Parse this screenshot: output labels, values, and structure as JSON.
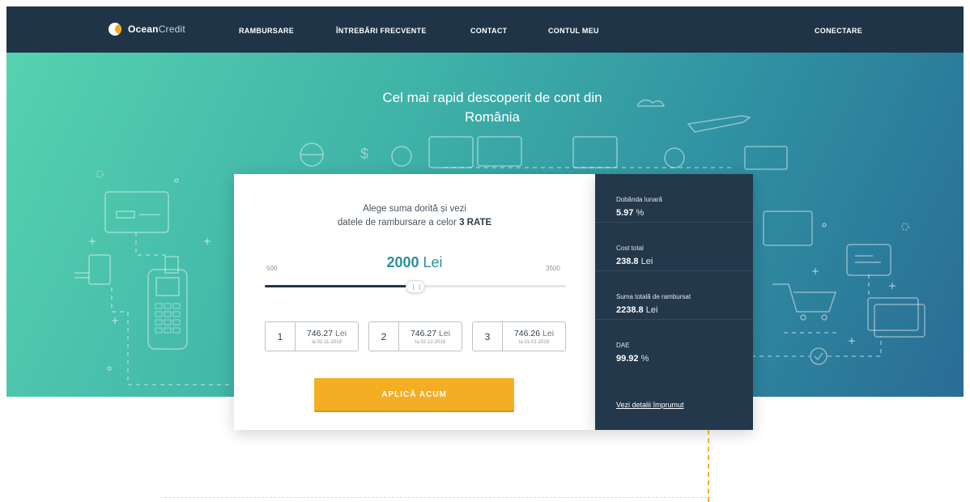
{
  "nav": {
    "brand_bold": "Ocean",
    "brand_light": "Credit",
    "links": [
      "RAMBURSARE",
      "ÎNTREBĂRI FRECVENTE",
      "CONTACT",
      "CONTUL MEU"
    ],
    "login": "CONECTARE"
  },
  "hero": {
    "title_line1": "Cel mai rapid descoperit de cont din",
    "title_line2": "România"
  },
  "calculator": {
    "heading_line1": "Alege suma dorită și vezi",
    "heading_line2_prefix": "datele de rambursare a celor",
    "heading_line2_bold": "3 RATE",
    "range_min": "500",
    "range_max": "3500",
    "amount_value": "2000",
    "amount_currency": "Lei",
    "slider_fraction": 0.5,
    "rates": [
      {
        "index": "1",
        "amount": "746.27",
        "currency": "Lei",
        "date": "la 02-11-2018"
      },
      {
        "index": "2",
        "amount": "746.27",
        "currency": "Lei",
        "date": "la 02-12-2018"
      },
      {
        "index": "3",
        "amount": "746.26",
        "currency": "Lei",
        "date": "la 01-01-2019"
      }
    ],
    "apply_label": "APLICĂ ACUM"
  },
  "summary": {
    "items": [
      {
        "label": "Dobânda lunară",
        "value": "5.97",
        "unit": "%"
      },
      {
        "label": "Cost total",
        "value": "238.8",
        "unit": "Lei"
      },
      {
        "label": "Suma totală de rambursat",
        "value": "2238.8",
        "unit": "Lei"
      },
      {
        "label": "DAE",
        "value": "99.92",
        "unit": "%"
      }
    ],
    "details_link": "Vezi detalii împrumut"
  },
  "colors": {
    "nav_bg": "#1f3447",
    "panel_bg": "#24384b",
    "accent": "#f4ae24",
    "amount": "#2a8fa0"
  }
}
